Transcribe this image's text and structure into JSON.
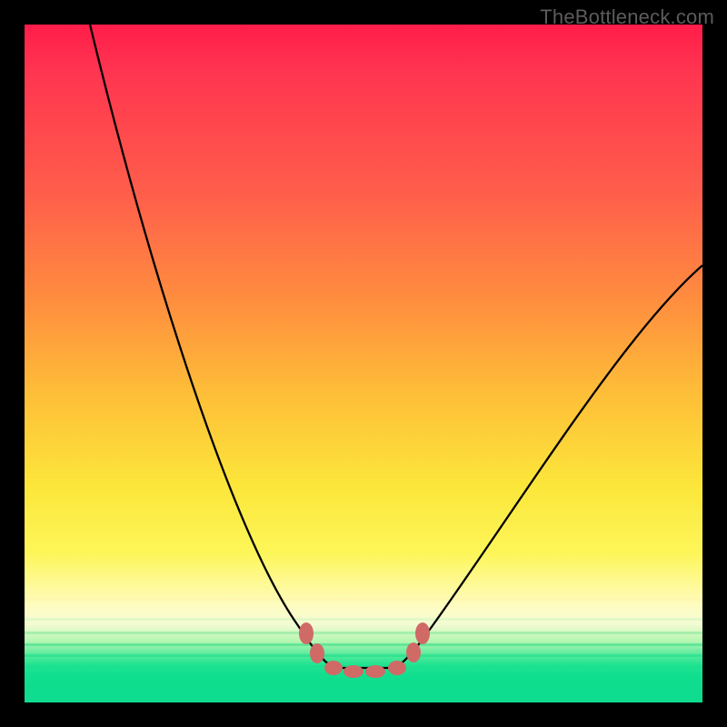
{
  "watermark": "TheBottleneck.com",
  "chart_data": {
    "type": "line",
    "title": "",
    "xlabel": "",
    "ylabel": "",
    "xlim": [
      0,
      100
    ],
    "ylim": [
      0,
      100
    ],
    "background_gradient": {
      "direction": "top-to-bottom",
      "stops": [
        {
          "pos": 0,
          "color": "#ff1d4a"
        },
        {
          "pos": 40,
          "color": "#ff8b3f"
        },
        {
          "pos": 68,
          "color": "#fce63a"
        },
        {
          "pos": 88,
          "color": "#f3fbd2"
        },
        {
          "pos": 100,
          "color": "#0edc8e"
        }
      ]
    },
    "series": [
      {
        "name": "bottleneck-curve",
        "color": "#000000",
        "x": [
          10,
          20,
          30,
          40,
          45,
          50,
          55,
          60,
          70,
          80,
          90,
          100
        ],
        "y": [
          100,
          70,
          45,
          20,
          8,
          5,
          5,
          8,
          25,
          45,
          57,
          65
        ]
      }
    ],
    "markers": {
      "name": "trough-beads",
      "color": "#d06a66",
      "x": [
        41,
        43,
        45,
        48,
        52,
        55,
        57,
        59
      ],
      "y": [
        11,
        8,
        5,
        4,
        4,
        5,
        8,
        11
      ]
    },
    "annotations": [
      {
        "text": "TheBottleneck.com",
        "position": "top-right",
        "color": "#5c5c5c"
      }
    ]
  }
}
